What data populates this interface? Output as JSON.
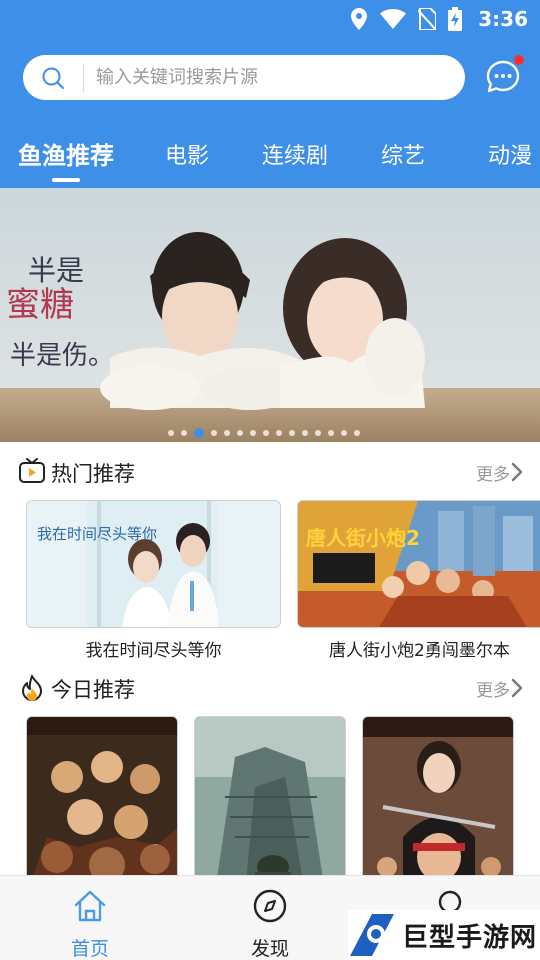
{
  "status_bar": {
    "time": "3:36",
    "icons": [
      "location-icon",
      "wifi-icon",
      "no-sim-icon",
      "battery-charging-icon"
    ]
  },
  "search": {
    "placeholder": "输入关键词搜索片源",
    "value": ""
  },
  "header": {
    "message_icon": "chat-bubble-icon",
    "has_unread": true
  },
  "tabs": [
    {
      "label": "鱼渔推荐",
      "active": true
    },
    {
      "label": "电影",
      "active": false
    },
    {
      "label": "连续剧",
      "active": false
    },
    {
      "label": "综艺",
      "active": false
    },
    {
      "label": "动漫",
      "active": false
    }
  ],
  "banner": {
    "poster_text_line1": "半是",
    "poster_text_line2": "蜜糖",
    "poster_text_line3": "半是伤。",
    "dot_count": 15,
    "active_dot": 2
  },
  "hot_section": {
    "title": "热门推荐",
    "more_label": "更多",
    "items": [
      {
        "title": "我在时间尽头等你",
        "poster_text": "我在时间尽头等你"
      },
      {
        "title": "唐人街小炮2勇闯墨尔本",
        "poster_text": "唐人街小炮2"
      }
    ]
  },
  "today_section": {
    "title": "今日推荐",
    "more_label": "更多",
    "items": [
      {
        "title": ""
      },
      {
        "title": ""
      },
      {
        "title": ""
      }
    ]
  },
  "bottom_nav": [
    {
      "label": "首页",
      "icon": "home-icon",
      "active": true
    },
    {
      "label": "发现",
      "icon": "compass-icon",
      "active": false
    },
    {
      "label": "",
      "icon": "profile-icon",
      "active": false
    }
  ],
  "watermark": {
    "text": "巨型手游网"
  },
  "colors": {
    "primary": "#3d8fe8",
    "badge": "#ff2d2d",
    "text_muted": "#9a9a9a"
  }
}
